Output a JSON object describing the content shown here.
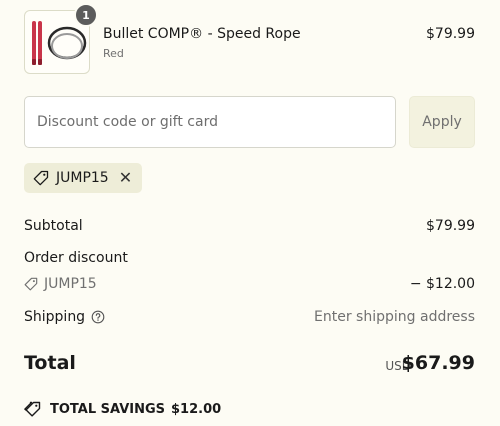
{
  "line_item": {
    "quantity": "1",
    "name": "Bullet COMP® - Speed Rope",
    "variant": "Red",
    "price": "$79.99"
  },
  "discount": {
    "placeholder": "Discount code or gift card",
    "value": "",
    "apply_label": "Apply",
    "applied_code": "JUMP15"
  },
  "summary": {
    "subtotal_label": "Subtotal",
    "subtotal_value": "$79.99",
    "order_discount_label": "Order discount",
    "discount_code": "JUMP15",
    "discount_value": "− $12.00",
    "shipping_label": "Shipping",
    "shipping_value": "Enter shipping address",
    "total_label": "Total",
    "currency": "USD",
    "total_value": "$67.99",
    "savings_label": "TOTAL SAVINGS",
    "savings_value": "$12.00"
  },
  "colors": {
    "background": "#fdfcf4",
    "chip_background": "#eeedd8",
    "rope_red": "#c9354a"
  },
  "icons": {
    "tag": "tag-icon",
    "close": "close-icon",
    "help": "question-circle-icon",
    "savings": "tags-icon"
  }
}
